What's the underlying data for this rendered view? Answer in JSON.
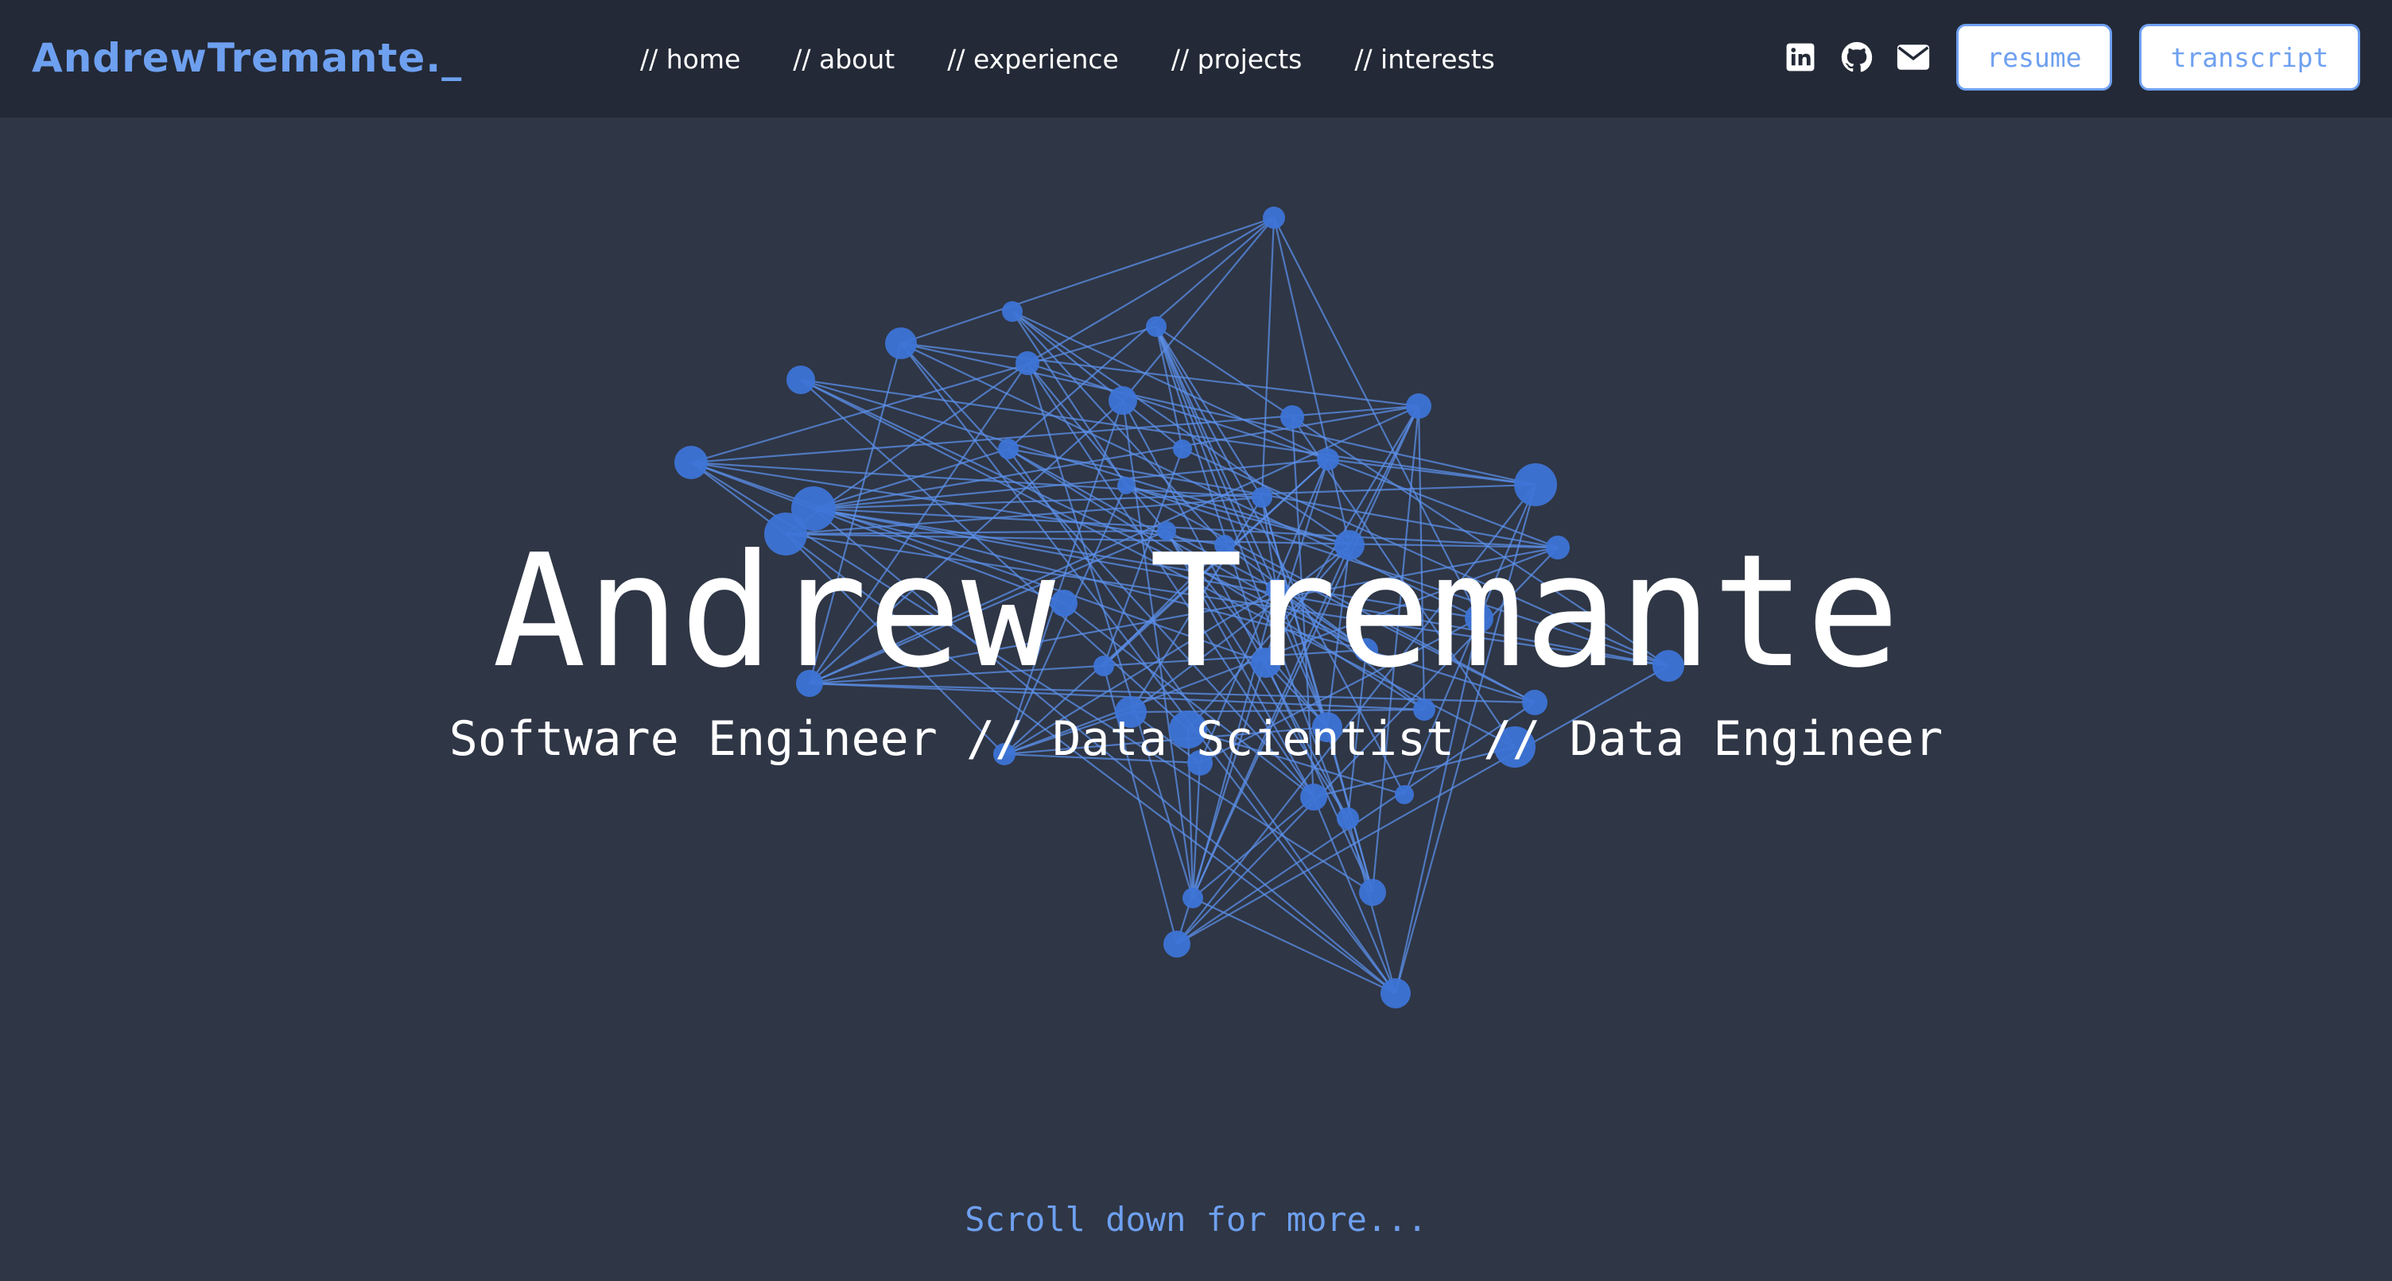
{
  "brand": {
    "name": "AndrewTremante._"
  },
  "nav": {
    "links": [
      {
        "label": "// home"
      },
      {
        "label": "// about"
      },
      {
        "label": "// experience"
      },
      {
        "label": "// projects"
      },
      {
        "label": "// interests"
      }
    ],
    "social": [
      {
        "icon": "linkedin-icon"
      },
      {
        "icon": "github-icon"
      },
      {
        "icon": "mail-icon"
      }
    ],
    "resume_label": "resume",
    "transcript_label": "transcript"
  },
  "hero": {
    "name": "Andrew Tremante",
    "subtitle": "Software Engineer // Data Scientist // Data Engineer",
    "scroll_hint": "Scroll down for more..."
  },
  "colors": {
    "page_background": "#2f3645",
    "navbar_background": "#232936",
    "accent": "#6ea0f0",
    "network_node": "#3d74d6",
    "network_edge": "#5b8fe8",
    "text": "#ffffff"
  }
}
